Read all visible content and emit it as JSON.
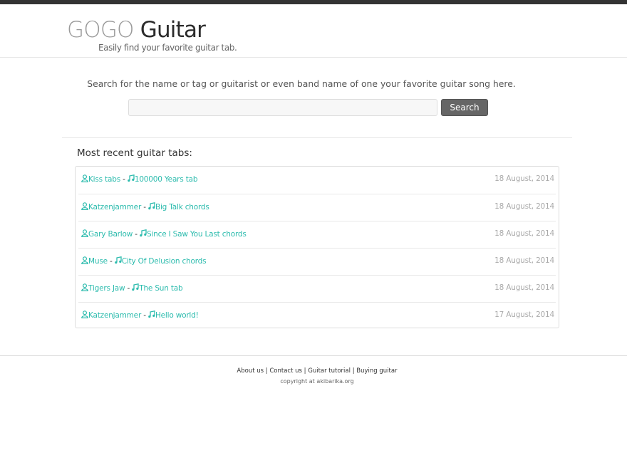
{
  "header": {
    "logo_light": "GOGO",
    "logo_dark": "Guitar",
    "tagline": "Easily find your favorite guitar tab."
  },
  "search": {
    "prompt": "Search for the name or tag or guitarist or even band name of one your favorite guitar song here.",
    "value": "",
    "placeholder": "",
    "button_label": "Search"
  },
  "recent": {
    "title": "Most recent guitar tabs:",
    "separator": "-",
    "items": [
      {
        "artist": "Kiss tabs",
        "song": "100000 Years tab",
        "date": "18 August, 2014"
      },
      {
        "artist": "Katzenjammer",
        "song": "Big Talk chords",
        "date": "18 August, 2014"
      },
      {
        "artist": "Gary Barlow",
        "song": "Since I Saw You Last chords",
        "date": "18 August, 2014"
      },
      {
        "artist": "Muse",
        "song": "City Of Delusion chords",
        "date": "18 August, 2014"
      },
      {
        "artist": "Tigers Jaw",
        "song": "The Sun tab",
        "date": "18 August, 2014"
      },
      {
        "artist": "Katzenjammer",
        "song": "Hello world!",
        "date": "17 August, 2014"
      }
    ]
  },
  "footer": {
    "links": [
      "About us",
      "Contact us",
      "Guitar tutorial",
      "Buying guitar"
    ],
    "link_separator": "|",
    "copyright": "copyright at akibarika.org"
  },
  "icons": {
    "artist": "user-icon",
    "song": "music-note-icon"
  },
  "colors": {
    "link": "#2bbbad",
    "topbar": "#333333",
    "button": "#666666",
    "date": "#aaaaaa"
  }
}
